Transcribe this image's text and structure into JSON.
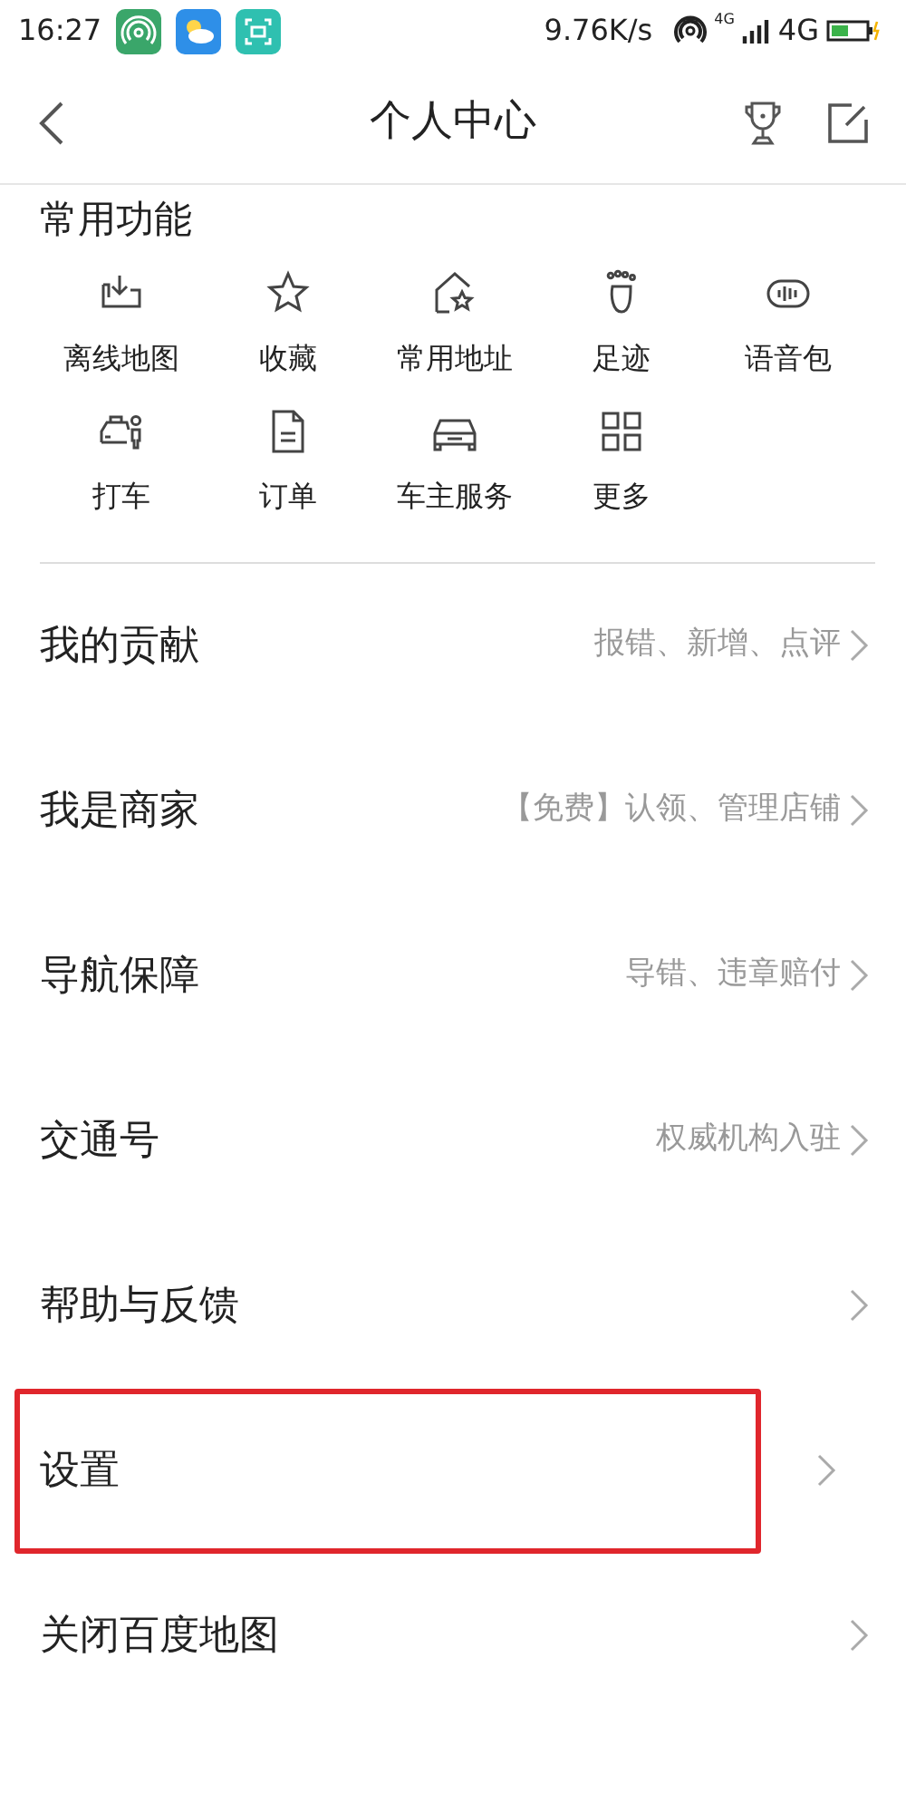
{
  "status_bar": {
    "time": "16:27",
    "speed": "9.76K/s",
    "signal_small": "4G",
    "network": "4G"
  },
  "header": {
    "title": "个人中心"
  },
  "functions": {
    "title": "常用功能",
    "items": [
      {
        "kind": "download",
        "label": "离线地图"
      },
      {
        "kind": "star",
        "label": "收藏"
      },
      {
        "kind": "home",
        "label": "常用地址"
      },
      {
        "kind": "foot",
        "label": "足迹"
      },
      {
        "kind": "voice",
        "label": "语音包"
      },
      {
        "kind": "taxi",
        "label": "打车"
      },
      {
        "kind": "doc",
        "label": "订单"
      },
      {
        "kind": "car",
        "label": "车主服务"
      },
      {
        "kind": "grid",
        "label": "更多"
      }
    ]
  },
  "menu": [
    {
      "title": "我的贡献",
      "detail": "报错、新增、点评",
      "highlighted": false
    },
    {
      "title": "我是商家",
      "detail": "【免费】认领、管理店铺",
      "highlighted": false
    },
    {
      "title": "导航保障",
      "detail": "导错、违章赔付",
      "highlighted": false
    },
    {
      "title": "交通号",
      "detail": "权威机构入驻",
      "highlighted": false
    },
    {
      "title": "帮助与反馈",
      "highlighted": false
    },
    {
      "title": "设置",
      "highlighted": true
    },
    {
      "title": "关闭百度地图",
      "highlighted": false
    }
  ]
}
